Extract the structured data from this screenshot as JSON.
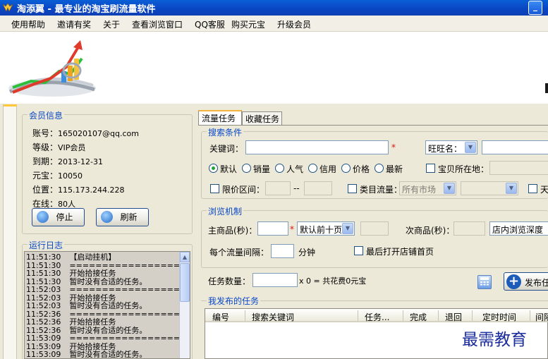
{
  "window": {
    "title": "淘添翼 - 最专业的淘宝刷流量软件",
    "minimize_label": "_"
  },
  "menu": [
    "使用帮助",
    "邀请有奖",
    "关于",
    "查看浏览窗口",
    "QQ客服",
    "购买元宝",
    "升级会员"
  ],
  "member": {
    "caption": "会员信息",
    "rows": [
      {
        "label": "账号：",
        "value": "165020107@qq.com"
      },
      {
        "label": "等级：",
        "value": "VIP会员"
      },
      {
        "label": "到期：",
        "value": "2013-12-31"
      },
      {
        "label": "元宝：",
        "value": "10050"
      },
      {
        "label": "位置：",
        "value": "115.173.244.228"
      },
      {
        "label": "在线：",
        "value": "80人"
      }
    ],
    "stop_label": "停止",
    "refresh_label": "刷新"
  },
  "log": {
    "caption": "运行日志",
    "lines": [
      {
        "time": "11:51:30",
        "text": "【启动挂机】"
      },
      {
        "time": "11:51:30",
        "text": "================================"
      },
      {
        "time": "11:51:30",
        "text": "开始拾接任务"
      },
      {
        "time": "11:51:30",
        "text": "暂时没有合适的任务。"
      },
      {
        "time": "11:52:03",
        "text": "================================"
      },
      {
        "time": "11:52:03",
        "text": "开始拾接任务"
      },
      {
        "time": "11:52:03",
        "text": "暂时没有合适的任务。"
      },
      {
        "time": "11:52:36",
        "text": "================================"
      },
      {
        "time": "11:52:36",
        "text": "开始拾接任务"
      },
      {
        "time": "11:52:36",
        "text": "暂时没有合适的任务。"
      },
      {
        "time": "11:53:09",
        "text": "================================"
      },
      {
        "time": "11:53:09",
        "text": "开始拾接任务"
      },
      {
        "time": "11:53:09",
        "text": "暂时没有合适的任务。"
      }
    ]
  },
  "tabs": {
    "traffic": "流量任务",
    "favorite": "收藏任务"
  },
  "search": {
    "caption": "搜索条件",
    "keyword_label": "关键词：",
    "keyword_value": "",
    "required_mark": "*",
    "wangwang_label": "旺旺名：",
    "sort_options": [
      "默认",
      "销量",
      "人气",
      "信用",
      "价格",
      "最新"
    ],
    "sort_selected": "默认",
    "location_label": "宝贝所在地：",
    "price_label": "限价区间：",
    "price_sep": "--",
    "category_label": "类目流量：",
    "market_value": "所有市场",
    "extra_label": "天"
  },
  "browse": {
    "caption": "浏览机制",
    "main_label": "主商品(秒)：",
    "main_select": "默认前十页",
    "sub_label": "次商品(秒)：",
    "depth_select": "店内浏览深度",
    "interval_label": "每个流量间隔：",
    "interval_unit": "分钟",
    "open_shop_label": "最后打开店铺首页"
  },
  "task": {
    "count_label": "任务数量：",
    "cost_text": "x 0 = 共花费0元宝",
    "publish_label": "发布任"
  },
  "published": {
    "caption": "我发布的任务",
    "columns": [
      "编号",
      "搜索关键词",
      "任务...",
      "完成",
      "退回",
      "定时时间",
      "间隔"
    ]
  },
  "watermark": "最需教育",
  "colors": {
    "title_blue": "#0a48c8",
    "group_caption": "#0a48c8",
    "required": "#e01010",
    "accent_tab": "#f3b33d"
  }
}
